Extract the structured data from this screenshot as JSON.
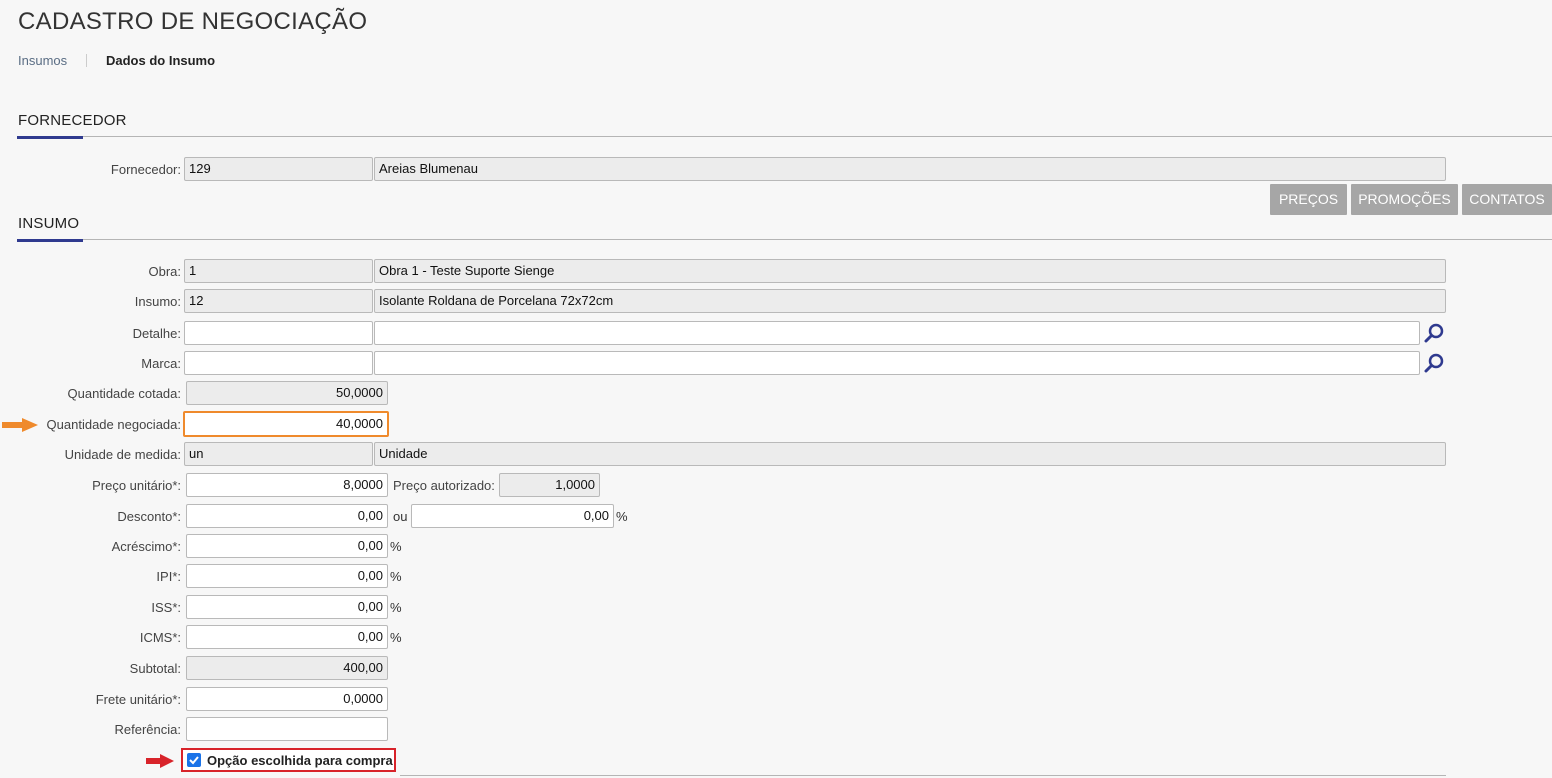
{
  "page": {
    "title": "CADASTRO DE NEGOCIAÇÃO",
    "breadcrumb": [
      "Insumos",
      "Dados do Insumo"
    ]
  },
  "fornecedor": {
    "section_title": "FORNECEDOR",
    "label": "Fornecedor:",
    "code": "129",
    "name": "Areias Blumenau"
  },
  "buttons": {
    "precos": "PREÇOS",
    "promocoes": "PROMOÇÕES",
    "contatos": "CONTATOS"
  },
  "insumo": {
    "section_title": "INSUMO",
    "obra": {
      "label": "Obra:",
      "code": "1",
      "name": "Obra 1 - Teste Suporte Sienge"
    },
    "insumo": {
      "label": "Insumo:",
      "code": "12",
      "name": "Isolante Roldana de Porcelana 72x72cm"
    },
    "detalhe": {
      "label": "Detalhe:",
      "code": "",
      "name": ""
    },
    "marca": {
      "label": "Marca:",
      "code": "",
      "name": ""
    },
    "quantidade_cotada": {
      "label": "Quantidade cotada:",
      "value": "50,0000"
    },
    "quantidade_negociada": {
      "label": "Quantidade negociada:",
      "value": "40,0000"
    },
    "unidade": {
      "label": "Unidade de medida:",
      "code": "un",
      "name": "Unidade"
    },
    "preco_unitario": {
      "label": "Preço unitário*:",
      "value": "8,0000"
    },
    "preco_autorizado": {
      "label": "Preço autorizado:",
      "value": "1,0000"
    },
    "desconto": {
      "label": "Desconto*:",
      "value": "0,00",
      "ou": "ou",
      "percent": "0,00",
      "suffix": "%"
    },
    "acrescimo": {
      "label": "Acréscimo*:",
      "value": "0,00",
      "suffix": "%"
    },
    "ipi": {
      "label": "IPI*:",
      "value": "0,00",
      "suffix": "%"
    },
    "iss": {
      "label": "ISS*:",
      "value": "0,00",
      "suffix": "%"
    },
    "icms": {
      "label": "ICMS*:",
      "value": "0,00",
      "suffix": "%"
    },
    "subtotal": {
      "label": "Subtotal:",
      "value": "400,00"
    },
    "frete": {
      "label": "Frete unitário*:",
      "value": "0,0000"
    },
    "referencia": {
      "label": "Referência:",
      "value": ""
    },
    "opcao_escolhida": {
      "label": "Opção escolhida para compra",
      "checked": true
    }
  },
  "colors": {
    "accent": "#2f3a8f",
    "button": "#a6a6a6",
    "highlight_orange": "#ef8a2c",
    "highlight_red": "#d8232a",
    "checkbox": "#1a73e8"
  }
}
